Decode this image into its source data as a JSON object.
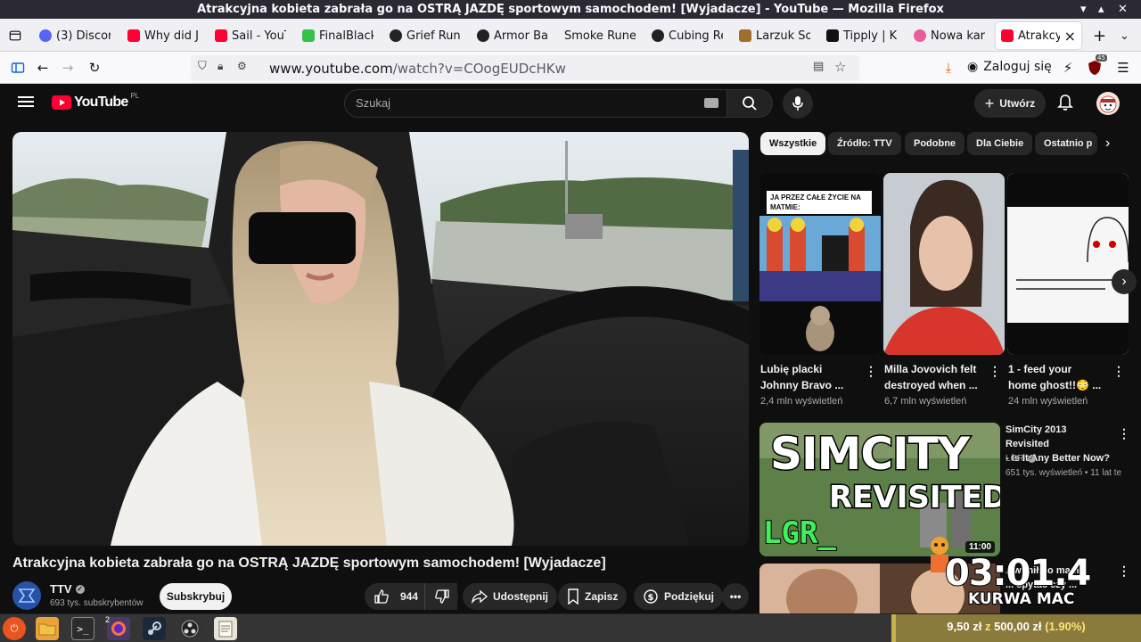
{
  "window": {
    "title": "Atrakcyjna kobieta zabrała go na OSTRĄ JAZDĘ sportowym samochodem! [Wyjadacze] - YouTube — Mozilla Firefox"
  },
  "tabs": [
    {
      "label": "(3) Discord",
      "icon": "discord-icon",
      "color": "#5865f2"
    },
    {
      "label": "Why did J",
      "icon": "youtube-icon",
      "color": "#ff0033"
    },
    {
      "label": "Sail - YouT",
      "icon": "youtube-icon",
      "color": "#ff0033"
    },
    {
      "label": "FinalBlack",
      "icon": "finalblack-icon",
      "color": "#36c24a"
    },
    {
      "label": "Grief Run",
      "icon": "runes-icon",
      "color": "#222222"
    },
    {
      "label": "Armor Ba",
      "icon": "runes-icon",
      "color": "#222222"
    },
    {
      "label": "Smoke Rune",
      "icon": "",
      "color": ""
    },
    {
      "label": "Cubing Re",
      "icon": "runes-icon",
      "color": "#222222"
    },
    {
      "label": "Larzuk So",
      "icon": "larzuk-icon",
      "color": "#a0702a"
    },
    {
      "label": "Tipply | K",
      "icon": "tipply-icon",
      "color": "#111111"
    },
    {
      "label": "Nowa kar",
      "icon": "circle-icon",
      "color": "#e85d9b"
    },
    {
      "label": "Atrakcyj",
      "icon": "youtube-icon",
      "color": "#ff0033"
    }
  ],
  "nav": {
    "url_host": "www.youtube.com",
    "url_path": "/watch?v=COogEUDcHKw",
    "login": "Zaloguj się",
    "ext_badge": "45"
  },
  "yt": {
    "logo": "YouTube",
    "region": "PL",
    "search_placeholder": "Szukaj",
    "create": "Utwórz",
    "video_title": "Atrakcyjna kobieta zabrała go na OSTRĄ JAZDĘ sportowym samochodem! [Wyjadacze]",
    "channel": "TTV",
    "subscribers": "693 tys. subskrybentów",
    "subscribe": "Subskrybuj",
    "likes": "944",
    "share": "Udostępnij",
    "save": "Zapisz",
    "thanks": "Podziękuj"
  },
  "chips": [
    "Wszystkie",
    "Źródło: TTV",
    "Podobne",
    "Dla Ciebie",
    "Ostatnio p"
  ],
  "shorts": [
    {
      "title1": "Lubię placki",
      "title2": "Johnny Bravo ...",
      "views": "2,4 mln wyświetleń",
      "caption1": "JA PRZEZ CAŁE ŻYCIE NA",
      "caption2": "MATMIE:"
    },
    {
      "title1": "Milla Jovovich felt",
      "title2": "destroyed when ...",
      "views": "6,7 mln wyświetleń"
    },
    {
      "title1": "1 - feed your",
      "title2": "home ghost!!😳 ...",
      "views": "24 mln wyświetleń"
    }
  ],
  "rec": [
    {
      "title1": "SimCity 2013 Revisited",
      "title2": "- Is It Any Better Now?",
      "channel": "LGR",
      "meta": "651 tys. wyświetleń • 11 lat te",
      "duration": "11:00",
      "thumb_line1": "SIMCITY",
      "thumb_line2": "REVISITED",
      "thumb_brand": "LGR_"
    },
    {
      "title1": "...wonił do mamy,",
      "title2": "... spytać czy ..."
    }
  ],
  "overlay": {
    "timer": "03:01.4",
    "caption": "KURWA MAC",
    "donation": "9,50 zł z 500,00 zł (1.90%)",
    "donation_amount": "9,50 zł",
    "donation_goal": "500,00 zł",
    "donation_pct": "(1.90%)"
  },
  "taskbar": {
    "firefox_count": "2"
  }
}
